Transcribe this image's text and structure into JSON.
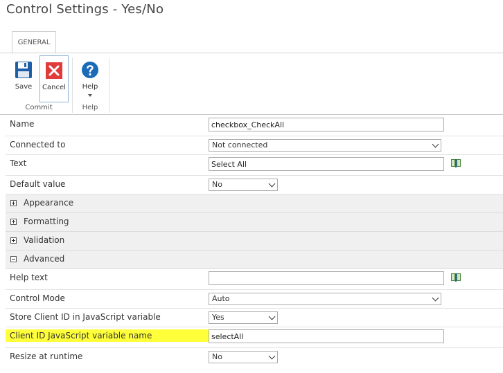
{
  "window": {
    "title": "Control Settings - Yes/No"
  },
  "ribbon": {
    "tab": "GENERAL",
    "buttons": {
      "save": "Save",
      "cancel": "Cancel",
      "help": "Help"
    },
    "groups": {
      "commit": "Commit",
      "help": "Help"
    },
    "icons": {
      "save": "floppy-disk-icon",
      "cancel": "red-x-icon",
      "help": "question-mark-icon"
    }
  },
  "fields": {
    "name": {
      "label": "Name",
      "value": "checkbox_CheckAll"
    },
    "connected_to": {
      "label": "Connected to",
      "value": "Not connected"
    },
    "text": {
      "label": "Text",
      "value": "Select All"
    },
    "default_value": {
      "label": "Default value",
      "value": "No"
    },
    "help_text": {
      "label": "Help text",
      "value": ""
    },
    "control_mode": {
      "label": "Control Mode",
      "value": "Auto"
    },
    "store_client_id": {
      "label": "Store Client ID in JavaScript variable",
      "value": "Yes"
    },
    "client_id_var": {
      "label": "Client ID JavaScript variable name",
      "value": "selectAll"
    },
    "resize": {
      "label": "Resize at runtime",
      "value": "No"
    }
  },
  "sections": {
    "appearance": "Appearance",
    "formatting": "Formatting",
    "validation": "Validation",
    "advanced": "Advanced"
  },
  "colors": {
    "highlight": "#ffff3a",
    "save_icon": "#1f5fa8",
    "cancel_icon": "#e03c3c",
    "help_icon": "#1a6bb8"
  }
}
